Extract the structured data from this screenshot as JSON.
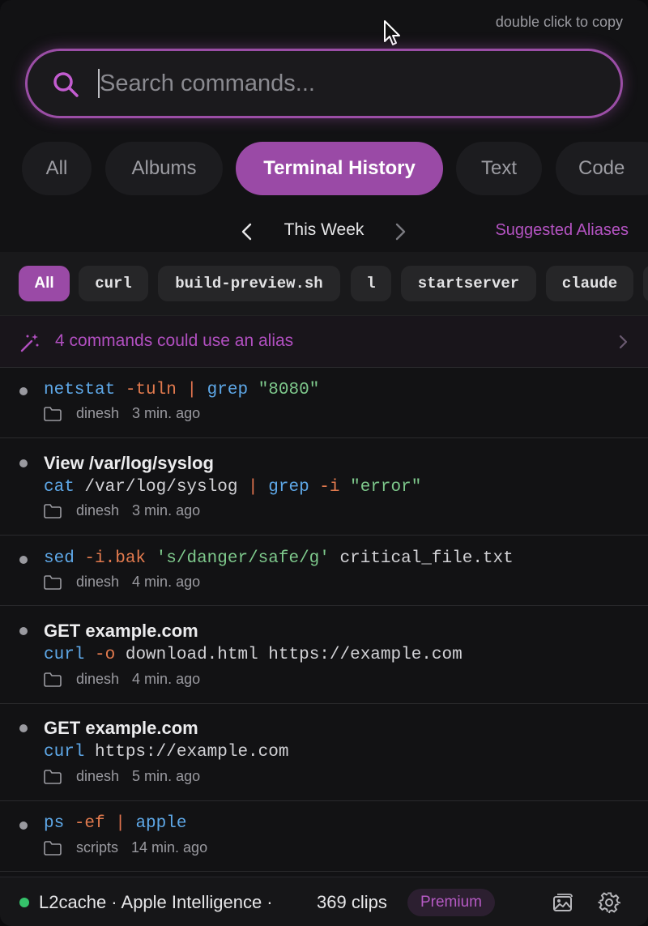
{
  "hint": "double click to copy",
  "search": {
    "placeholder": "Search commands..."
  },
  "tabs": [
    {
      "label": "All"
    },
    {
      "label": "Albums"
    },
    {
      "label": "Terminal History"
    },
    {
      "label": "Text"
    },
    {
      "label": "Code"
    }
  ],
  "active_tab": "Terminal History",
  "week_nav": {
    "label": "This Week",
    "suggest_label": "Suggested Aliases"
  },
  "filters": [
    {
      "label": "All"
    },
    {
      "label": "curl"
    },
    {
      "label": "build-preview.sh"
    },
    {
      "label": "l"
    },
    {
      "label": "startserver"
    },
    {
      "label": "claude"
    }
  ],
  "alias_banner": {
    "text": "4 commands could use an alias"
  },
  "history": [
    {
      "title": "",
      "command": [
        [
          "netstat",
          "cmd"
        ],
        [
          " ",
          "arg"
        ],
        [
          "-tuln",
          "flag"
        ],
        [
          " | ",
          "pipe"
        ],
        [
          "grep",
          "cmd"
        ],
        [
          " ",
          "arg"
        ],
        [
          "\"8080\"",
          "str"
        ]
      ],
      "folder": "dinesh",
      "time": "3 min. ago"
    },
    {
      "title": "View /var/log/syslog",
      "command": [
        [
          "cat",
          "cmd"
        ],
        [
          " /var/log/syslog",
          "arg"
        ],
        [
          " | ",
          "pipe"
        ],
        [
          "grep",
          "cmd"
        ],
        [
          " ",
          "arg"
        ],
        [
          "-i",
          "flag"
        ],
        [
          " ",
          "arg"
        ],
        [
          "\"error\"",
          "str"
        ]
      ],
      "folder": "dinesh",
      "time": "3 min. ago"
    },
    {
      "title": "",
      "command": [
        [
          "sed",
          "cmd"
        ],
        [
          " ",
          "arg"
        ],
        [
          "-i.bak",
          "flag"
        ],
        [
          " ",
          "arg"
        ],
        [
          "'s/danger/safe/g'",
          "str"
        ],
        [
          " critical_file.txt",
          "arg"
        ]
      ],
      "folder": "dinesh",
      "time": "4 min. ago"
    },
    {
      "title": "GET example.com",
      "command": [
        [
          "curl",
          "cmd"
        ],
        [
          " ",
          "arg"
        ],
        [
          "-o",
          "flag"
        ],
        [
          " download.html https://example.com",
          "arg"
        ]
      ],
      "folder": "dinesh",
      "time": "4 min. ago"
    },
    {
      "title": "GET example.com",
      "command": [
        [
          "curl",
          "cmd"
        ],
        [
          " https://example.com",
          "arg"
        ]
      ],
      "folder": "dinesh",
      "time": "5 min. ago"
    },
    {
      "title": "",
      "command": [
        [
          "ps",
          "cmd"
        ],
        [
          " ",
          "arg"
        ],
        [
          "-ef",
          "flag"
        ],
        [
          " | ",
          "pipe"
        ],
        [
          "apple",
          "cmd"
        ]
      ],
      "folder": "scripts",
      "time": "14 min. ago"
    }
  ],
  "footer": {
    "app_label": "L2cache · Apple Intelligence ·",
    "clips": "369 clips",
    "badge": "Premium",
    "status_color": "#35c26a"
  },
  "colors": {
    "accent": "#9a4aa6",
    "background": "#121214"
  }
}
